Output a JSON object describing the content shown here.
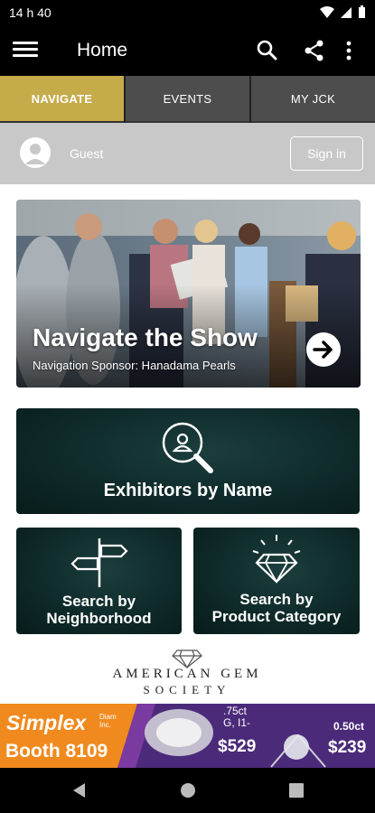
{
  "status_bar": {
    "time": "14 h 40"
  },
  "app_bar": {
    "title": "Home"
  },
  "tabs": [
    {
      "label": "NAVIGATE",
      "active": true
    },
    {
      "label": "EVENTS",
      "active": false
    },
    {
      "label": "MY JCK",
      "active": false
    }
  ],
  "user": {
    "name": "Guest",
    "sign_in_label": "Sign in"
  },
  "hero": {
    "title": "Navigate the Show",
    "subtitle": "Navigation Sponsor: Hanadama Pearls"
  },
  "tiles": {
    "exhibitors_by_name": "Exhibitors by Name",
    "search_by_neighborhood_line1": "Search by",
    "search_by_neighborhood_line2": "Neighborhood",
    "search_by_product_line1": "Search by",
    "search_by_product_line2": "Product Category"
  },
  "logo": {
    "line1": "AMERICAN GEM",
    "line2": "SOCIETY"
  },
  "ad": {
    "brand": "Simplex",
    "brand_tag": "Diam Inc.",
    "booth": "Booth 8109",
    "offer1_line1": ".75ct",
    "offer1_line2": "G, I1-",
    "offer1_price": "$529",
    "offer2_carat": "0.50ct",
    "offer2_price": "$239"
  },
  "colors": {
    "accent": "#c5ab4a",
    "tab_inactive": "#4d4d4d",
    "tile_bg": "#0e2a29",
    "ad_orange": "#f08a1e",
    "ad_purple": "#4b2a7a"
  },
  "icons": [
    "menu-icon",
    "search-icon",
    "share-icon",
    "more-vert-icon",
    "person-icon",
    "arrow-right-icon",
    "search-person-icon",
    "signpost-icon",
    "diamond-icon",
    "back-icon",
    "home-icon",
    "recents-icon"
  ]
}
